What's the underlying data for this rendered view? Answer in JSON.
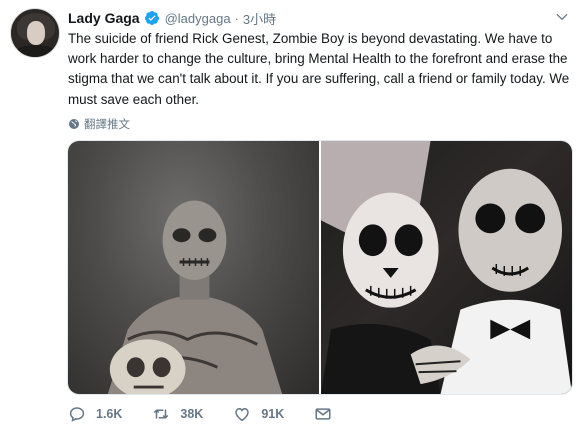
{
  "user": {
    "display_name": "Lady Gaga",
    "handle": "@ladygaga",
    "separator": "·",
    "time": "3小時"
  },
  "tweet": {
    "text": "The suicide of friend Rick Genest, Zombie Boy is beyond devastating. We have to work harder to change the culture, bring Mental Health to the forefront and erase the stigma that we can't talk about it. If you are suffering, call a friend or family today. We must save each other.",
    "translate_label": "翻譯推文"
  },
  "actions": {
    "reply_count": "1.6K",
    "retweet_count": "38K",
    "like_count": "91K"
  },
  "colors": {
    "text": "#14171a",
    "secondary": "#657786",
    "verified": "#1da1f2"
  },
  "icons": [
    "verified-badge-icon",
    "chevron-down-icon",
    "globe-icon",
    "reply-icon",
    "retweet-icon",
    "like-icon",
    "direct-message-icon"
  ]
}
